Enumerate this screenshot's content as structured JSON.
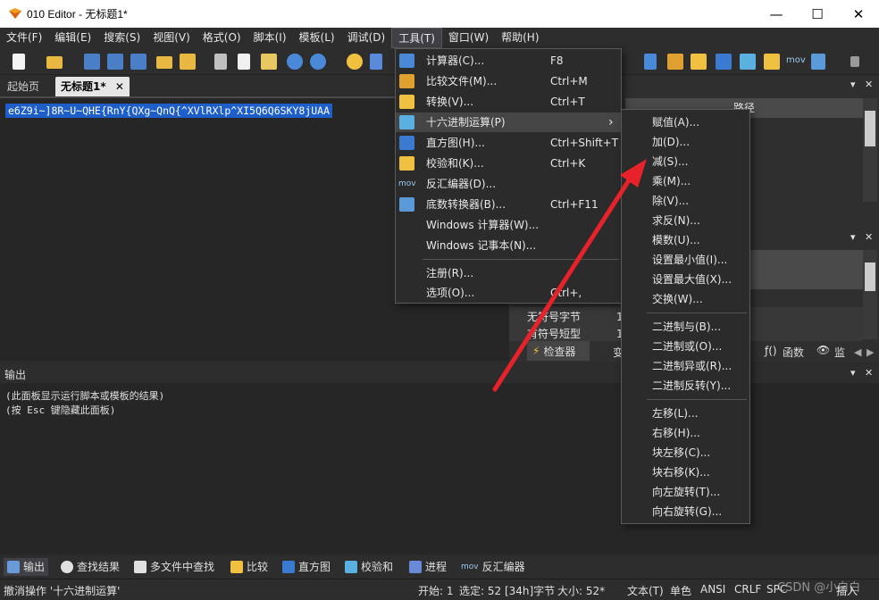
{
  "window": {
    "title": "010 Editor - 无标题1*",
    "minimize": "—",
    "maximize": "☐",
    "close": "✕"
  },
  "menubar": [
    {
      "label": "文件(F)"
    },
    {
      "label": "编辑(E)"
    },
    {
      "label": "搜索(S)"
    },
    {
      "label": "视图(V)"
    },
    {
      "label": "格式(O)"
    },
    {
      "label": "脚本(I)"
    },
    {
      "label": "模板(L)"
    },
    {
      "label": "调试(D)"
    },
    {
      "label": "工具(T)"
    },
    {
      "label": "窗口(W)"
    },
    {
      "label": "帮助(H)"
    }
  ],
  "tabs": {
    "start_page": "起始页",
    "current": "无标题1*",
    "close_glyph": "✕"
  },
  "editor": {
    "selected_text": "e6Z9i~]8R~U~QHE{RnY{QXg~QnQ{^XVlRXlp^XI5Q6Q6SKY8jUAA"
  },
  "right_panel": {
    "path_header": "路径",
    "rows": [
      {
        "label": "无符号字节",
        "value": "1"
      },
      {
        "label": "有符号短型",
        "value": "1"
      }
    ],
    "inspector_tab": "检查器",
    "var_tab_fragment": "变",
    "functions_tab": "函数",
    "watch_tab": "监",
    "panel_icons": {
      "dropdown": "▾",
      "close": "✕"
    },
    "scroll_arrows": {
      "up": "▲",
      "down": "▼",
      "left": "◀",
      "right": "▶"
    }
  },
  "tools_menu": {
    "items": [
      {
        "label": "计算器(C)...",
        "shortcut": "F8",
        "icon": "calculator-icon"
      },
      {
        "label": "比较文件(M)...",
        "shortcut": "Ctrl+M",
        "icon": "compare-icon"
      },
      {
        "label": "转换(V)...",
        "shortcut": "Ctrl+T",
        "icon": "convert-icon"
      },
      {
        "label": "十六进制运算(P)",
        "shortcut": "",
        "icon": "hex-operations-icon",
        "submenu_arrow": "›"
      },
      {
        "label": "直方图(H)...",
        "shortcut": "Ctrl+Shift+T",
        "icon": "histogram-icon"
      },
      {
        "label": "校验和(K)...",
        "shortcut": "Ctrl+K",
        "icon": "checksum-icon"
      },
      {
        "label": "反汇编器(D)...",
        "shortcut": "",
        "icon": "disassembler-icon"
      },
      {
        "label": "底数转换器(B)...",
        "shortcut": "Ctrl+F11",
        "icon": "base-converter-icon"
      },
      {
        "label": "Windows 计算器(W)...",
        "shortcut": ""
      },
      {
        "label": "Windows 记事本(N)...",
        "shortcut": ""
      },
      {
        "label": "注册(R)...",
        "shortcut": ""
      },
      {
        "label": "选项(O)...",
        "shortcut": "Ctrl+,"
      }
    ]
  },
  "hex_ops_submenu": {
    "items": [
      "赋值(A)...",
      "加(D)...",
      "减(S)...",
      "乘(M)...",
      "除(V)...",
      "求反(N)...",
      "模数(U)...",
      "设置最小值(I)...",
      "设置最大值(X)...",
      "交换(W)...",
      "二进制与(B)...",
      "二进制或(O)...",
      "二进制异或(R)...",
      "二进制反转(Y)...",
      "左移(L)...",
      "右移(H)...",
      "块左移(C)...",
      "块右移(K)...",
      "向左旋转(T)...",
      "向右旋转(G)..."
    ]
  },
  "output": {
    "title": "输出",
    "lines": [
      "(此面板显示运行脚本或模板的结果)",
      "(按 Esc 键隐藏此面板)"
    ]
  },
  "bottom_tabs": [
    {
      "label": "输出",
      "icon": "output-icon"
    },
    {
      "label": "查找结果",
      "icon": "find-results-icon"
    },
    {
      "label": "多文件中查找",
      "icon": "find-in-files-icon"
    },
    {
      "label": "比较",
      "icon": "compare-icon"
    },
    {
      "label": "直方图",
      "icon": "histogram-icon"
    },
    {
      "label": "校验和",
      "icon": "checksum-icon"
    },
    {
      "label": "进程",
      "icon": "process-icon"
    },
    {
      "label": "反汇编器",
      "icon": "disassembler-icon"
    }
  ],
  "toolbar": {
    "mov_label": "mov"
  },
  "status": {
    "message": "撤消操作 '十六进制运算'",
    "start": "开始: 1",
    "selection": "选定: 52 [34h]字节",
    "size": "大小: 52*",
    "mode": "文本(T)",
    "color": "单色",
    "encoding": "ANSI",
    "eol": "CRLF",
    "spc": "SPC",
    "insert": "插入",
    "watermark": "CSDN @小白白"
  },
  "colors": {
    "accent_arrow": "#e8222a",
    "selection": "#1e5ec8"
  }
}
